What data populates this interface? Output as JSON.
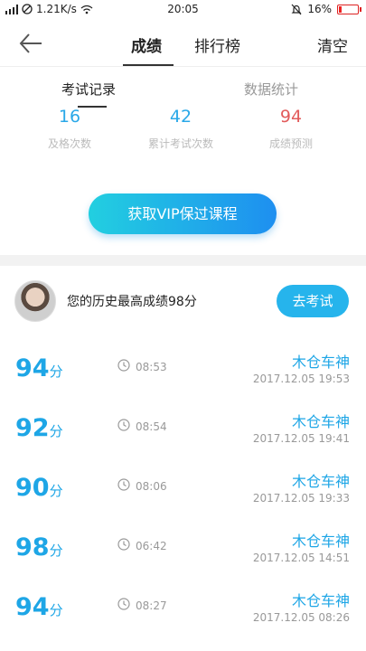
{
  "status_bar": {
    "speed": "1.21K/s",
    "time": "20:05",
    "battery": "16%"
  },
  "nav": {
    "tab_grade": "成绩",
    "tab_rank": "排行榜",
    "clear": "清空"
  },
  "subtabs": {
    "records": "考试记录",
    "stats": "数据统计"
  },
  "stats": [
    {
      "value": "16",
      "label": "及格次数",
      "color": "#2aa8e8"
    },
    {
      "value": "42",
      "label": "累计考试次数",
      "color": "#2aa8e8"
    },
    {
      "value": "94",
      "label": "成绩预测",
      "color": "#e25b5b"
    }
  ],
  "vip_button": "获取VIP保过课程",
  "profile": {
    "best_text": "您的历史最高成绩98分",
    "exam_button": "去考试"
  },
  "records": [
    {
      "score": "94",
      "unit": "分",
      "duration": "08:53",
      "name": "木仓车神",
      "datetime": "2017.12.05  19:53"
    },
    {
      "score": "92",
      "unit": "分",
      "duration": "08:54",
      "name": "木仓车神",
      "datetime": "2017.12.05  19:41"
    },
    {
      "score": "90",
      "unit": "分",
      "duration": "08:06",
      "name": "木仓车神",
      "datetime": "2017.12.05  19:33"
    },
    {
      "score": "98",
      "unit": "分",
      "duration": "06:42",
      "name": "木仓车神",
      "datetime": "2017.12.05  14:51"
    },
    {
      "score": "94",
      "unit": "分",
      "duration": "08:27",
      "name": "木仓车神",
      "datetime": "2017.12.05  08:26"
    }
  ]
}
